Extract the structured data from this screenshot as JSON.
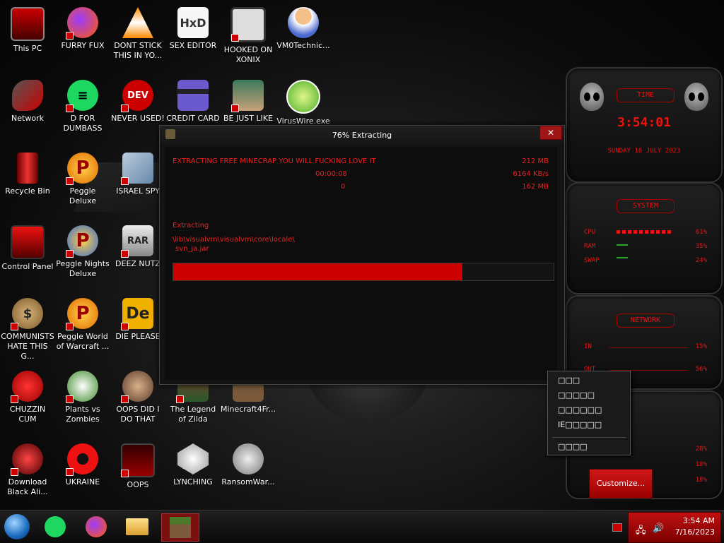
{
  "desktop_icons": [
    {
      "label": "This PC",
      "icon": "monitor-icon"
    },
    {
      "label": "FURRY FUX",
      "icon": "firefox-icon"
    },
    {
      "label": "DONT STICK THIS IN YO...",
      "icon": "vlc-cone-icon"
    },
    {
      "label": "SEX EDITOR",
      "icon": "hxd-icon"
    },
    {
      "label": "HOOKED ON XONIX",
      "icon": "xonix-game-icon"
    },
    {
      "label": "VM0Technic...",
      "icon": "doctor-icon"
    },
    {
      "label": "Network",
      "icon": "network-icon"
    },
    {
      "label": "D FOR DUMBASS",
      "icon": "chat-app-icon"
    },
    {
      "label": "NEVER USED!",
      "icon": "devcpp-icon"
    },
    {
      "label": "CREDIT CARD",
      "icon": "credit-card-icon"
    },
    {
      "label": "BE JUST LIKE",
      "icon": "elf-icon"
    },
    {
      "label": "VirusWire.exe",
      "icon": "lime-icon"
    },
    {
      "label": "Recycle Bin",
      "icon": "recycle-bin-icon"
    },
    {
      "label": "Peggle Deluxe",
      "icon": "peggle-icon"
    },
    {
      "label": "ISRAEL SPY",
      "icon": "satellite-icon"
    },
    {
      "label": "Control Panel",
      "icon": "control-panel-icon"
    },
    {
      "label": "Peggle Nights Deluxe",
      "icon": "peggle-nights-icon"
    },
    {
      "label": "DEEZ NUTZ",
      "icon": "winrar-icon"
    },
    {
      "label": "COMMUNISTS HATE THIS G...",
      "icon": "money-bag-icon"
    },
    {
      "label": "Peggle World of Warcraft ...",
      "icon": "peggle-wow-icon"
    },
    {
      "label": "DIE PLEASE",
      "icon": "de-icon"
    },
    {
      "label": "CHUZZIN CUM",
      "icon": "chuzzle-icon"
    },
    {
      "label": "Plants vs Zombies",
      "icon": "pvz-icon"
    },
    {
      "label": "OOPS DID I DO THAT",
      "icon": "portrait-icon"
    },
    {
      "label": "The Legend of Zilda",
      "icon": "zelda-icon"
    },
    {
      "label": "Minecraft4Fr...",
      "icon": "minecraft-icon"
    },
    {
      "label": "Download Black Ali...",
      "icon": "alienware-icon"
    },
    {
      "label": "UKRAINE",
      "icon": "radiation-icon"
    },
    {
      "label": "OOPS",
      "icon": "terminal-icon"
    },
    {
      "label": "LYNCHING",
      "icon": "gear-flag-icon"
    },
    {
      "label": "RansomWar...",
      "icon": "skull-icon"
    }
  ],
  "extract_window": {
    "title": "76% Extracting",
    "close_label": "✕",
    "file_line": "EXTRACTING FREE MINECRAP YOU WILL FUCKING LOVE IT",
    "size_total": "212 MB",
    "elapsed": "00:00:08",
    "speed": "6164 KB/s",
    "remaining": "0",
    "size_done": "162 MB",
    "status": "Extracting",
    "path_line1": "\\lib\\visualvm\\visualvm\\core\\locale\\",
    "path_line2": "svn_ja.jar",
    "progress": 0.76
  },
  "gadgets": {
    "time": {
      "title": "TIME",
      "time": "3:54:01",
      "date": "SUNDAY 16 JULY 2023"
    },
    "system": {
      "title": "SYSTEM",
      "rows": [
        {
          "label": "CPU",
          "value": "61%"
        },
        {
          "label": "RAM",
          "value": "35%"
        },
        {
          "label": "SWAP",
          "value": "24%"
        }
      ]
    },
    "network": {
      "title": "NETWORK",
      "rows": [
        {
          "label": "IN",
          "value": "15%"
        },
        {
          "label": "OUT",
          "value": "56%"
        }
      ]
    },
    "disk": {
      "rows": [
        {
          "value": "28%"
        },
        {
          "value": "18%"
        },
        {
          "value": "18%"
        }
      ]
    }
  },
  "context_menu": {
    "items": [
      "□□□",
      "□□□□□",
      "□□□□□□",
      "IE□□□□□",
      "□□□□"
    ]
  },
  "customize_label": "Customize...",
  "taskbar": {
    "items": [
      "start-orb-icon",
      "chat-app-icon",
      "firefox-icon",
      "file-explorer-icon",
      "minecraft-icon"
    ],
    "time": "3:54 AM",
    "date": "7/16/2023"
  },
  "colors": {
    "accent": "#cc0000",
    "text_red": "#e22222"
  }
}
